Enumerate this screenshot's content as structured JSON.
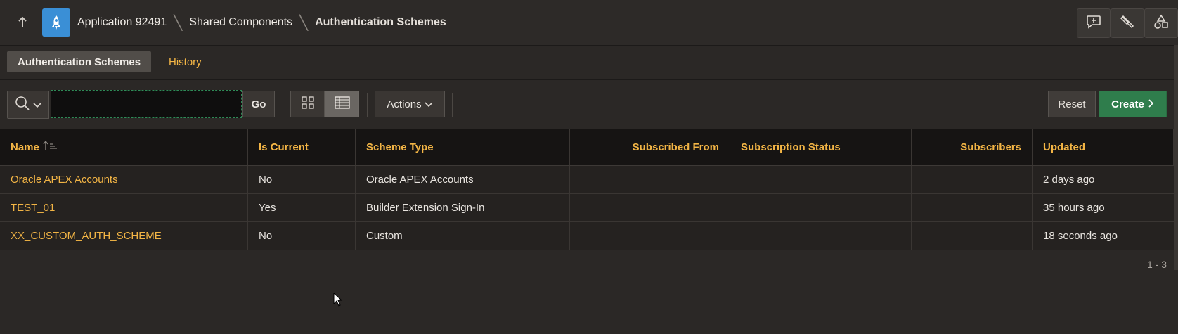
{
  "header": {
    "up_icon": "arrow-up-icon",
    "app_icon": "rocket-icon",
    "breadcrumb": [
      "Application 92491",
      "Shared Components",
      "Authentication Schemes"
    ],
    "buttons": [
      "comment-plus-icon",
      "brush-icon",
      "shapes-icon"
    ]
  },
  "tabs": [
    {
      "label": "Authentication Schemes",
      "active": true
    },
    {
      "label": "History",
      "active": false
    }
  ],
  "toolbar": {
    "search_icon": "search-icon",
    "search_value": "",
    "go_label": "Go",
    "actions_label": "Actions",
    "reset_label": "Reset",
    "create_label": "Create"
  },
  "table": {
    "columns": [
      "Name",
      "Is Current",
      "Scheme Type",
      "Subscribed From",
      "Subscription Status",
      "Subscribers",
      "Updated"
    ],
    "rows": [
      {
        "name": "Oracle APEX Accounts",
        "is_current": "No",
        "scheme_type": "Oracle APEX Accounts",
        "subscribed_from": "",
        "subscription_status": "",
        "subscribers": "",
        "updated": "2 days ago"
      },
      {
        "name": "TEST_01",
        "is_current": "Yes",
        "scheme_type": "Builder Extension Sign-In",
        "subscribed_from": "",
        "subscription_status": "",
        "subscribers": "",
        "updated": "35 hours ago"
      },
      {
        "name": "XX_CUSTOM_AUTH_SCHEME",
        "is_current": "No",
        "scheme_type": "Custom",
        "subscribed_from": "",
        "subscription_status": "",
        "subscribers": "",
        "updated": "18 seconds ago"
      }
    ]
  },
  "pagination": "1 - 3",
  "colors": {
    "accent": "#f3b545",
    "create": "#2f7d4c",
    "app_icon_bg": "#3a8fd6"
  }
}
